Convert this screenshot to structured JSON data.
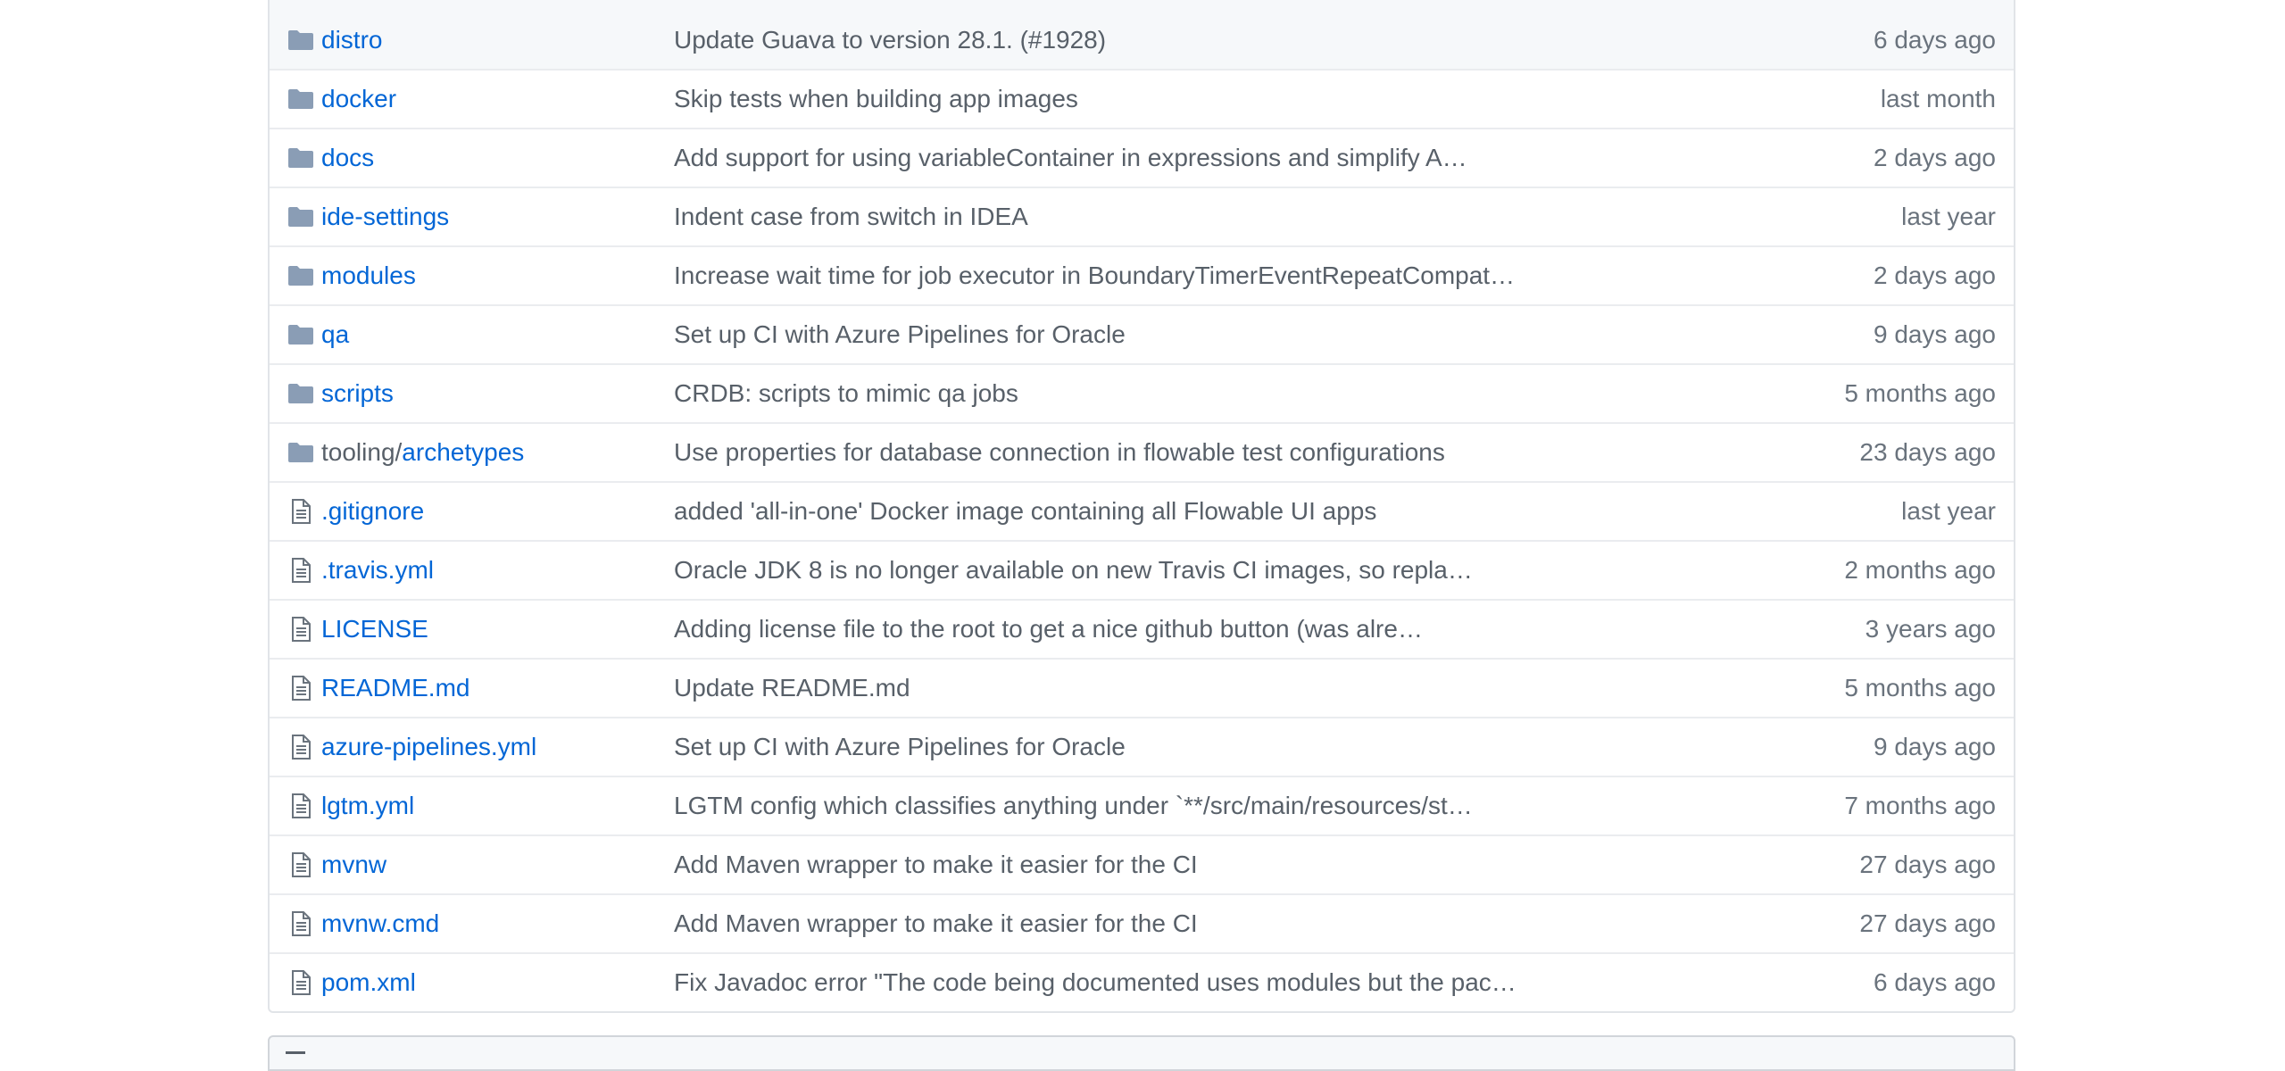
{
  "colors": {
    "link": "#0366d6",
    "muted": "#586069",
    "folder_icon": "#79b8ff",
    "file_icon": "#6a737d"
  },
  "rows": [
    {
      "type": "dir",
      "icon": "folder-icon",
      "prefix": "",
      "name": "distro",
      "message": "Update Guava to version 28.1. (#1928)",
      "age": "6 days ago"
    },
    {
      "type": "dir",
      "icon": "folder-icon",
      "prefix": "",
      "name": "docker",
      "message": "Skip tests when building app images",
      "age": "last month"
    },
    {
      "type": "dir",
      "icon": "folder-icon",
      "prefix": "",
      "name": "docs",
      "message": "Add support for using variableContainer in expressions and simplify A…",
      "age": "2 days ago"
    },
    {
      "type": "dir",
      "icon": "folder-icon",
      "prefix": "",
      "name": "ide-settings",
      "message": "Indent case from switch in IDEA",
      "age": "last year"
    },
    {
      "type": "dir",
      "icon": "folder-icon",
      "prefix": "",
      "name": "modules",
      "message": "Increase wait time for job executor in BoundaryTimerEventRepeatCompat…",
      "age": "2 days ago"
    },
    {
      "type": "dir",
      "icon": "folder-icon",
      "prefix": "",
      "name": "qa",
      "message": "Set up CI with Azure Pipelines for Oracle",
      "age": "9 days ago"
    },
    {
      "type": "dir",
      "icon": "folder-icon",
      "prefix": "",
      "name": "scripts",
      "message": "CRDB: scripts to mimic qa jobs",
      "age": "5 months ago"
    },
    {
      "type": "dir",
      "icon": "folder-icon",
      "prefix": "tooling/",
      "name": "archetypes",
      "message": "Use properties for database connection in flowable test configurations",
      "age": "23 days ago"
    },
    {
      "type": "file",
      "icon": "file-icon",
      "prefix": "",
      "name": ".gitignore",
      "message": "added 'all-in-one' Docker image containing all Flowable UI apps",
      "age": "last year"
    },
    {
      "type": "file",
      "icon": "file-icon",
      "prefix": "",
      "name": ".travis.yml",
      "message": "Oracle JDK 8 is no longer available on new Travis CI images, so repla…",
      "age": "2 months ago"
    },
    {
      "type": "file",
      "icon": "file-icon",
      "prefix": "",
      "name": "LICENSE",
      "message": "Adding license file to the root to get a nice github button (was alre…",
      "age": "3 years ago"
    },
    {
      "type": "file",
      "icon": "file-icon",
      "prefix": "",
      "name": "README.md",
      "message": "Update README.md",
      "age": "5 months ago"
    },
    {
      "type": "file",
      "icon": "file-icon",
      "prefix": "",
      "name": "azure-pipelines.yml",
      "message": "Set up CI with Azure Pipelines for Oracle",
      "age": "9 days ago"
    },
    {
      "type": "file",
      "icon": "file-icon",
      "prefix": "",
      "name": "lgtm.yml",
      "message": "LGTM config which classifies anything under `**/src/main/resources/st…",
      "age": "7 months ago"
    },
    {
      "type": "file",
      "icon": "file-icon",
      "prefix": "",
      "name": "mvnw",
      "message": "Add Maven wrapper to make it easier for the CI",
      "age": "27 days ago"
    },
    {
      "type": "file",
      "icon": "file-icon",
      "prefix": "",
      "name": "mvnw.cmd",
      "message": "Add Maven wrapper to make it easier for the CI",
      "age": "27 days ago"
    },
    {
      "type": "file",
      "icon": "file-icon",
      "prefix": "",
      "name": "pom.xml",
      "message": "Fix Javadoc error \"The code being documented uses modules but the pac…",
      "age": "6 days ago"
    }
  ]
}
